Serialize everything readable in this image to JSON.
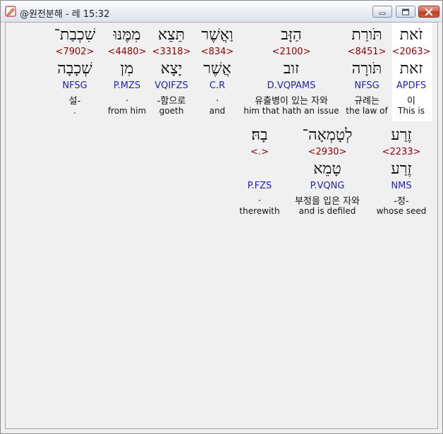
{
  "window": {
    "title": "@원전분해 - 레 15:32",
    "icon": "pencil-icon",
    "controls": {
      "minimize": "minimize-icon",
      "maximize": "maximize-icon",
      "close": "close-icon"
    }
  },
  "colors": {
    "strong": "#8b0000",
    "morph": "#2222b8",
    "text": "#111111",
    "selection": "#ffffff"
  },
  "words": [
    {
      "hebrew": "זֹאת",
      "strong": "<2063>",
      "lemma": "זאת",
      "morph": "APDFS",
      "korean": "이",
      "english": "This is",
      "selected": true
    },
    {
      "hebrew": "תֹּורַת",
      "strong": "<8451>",
      "lemma": "תֹּורָה",
      "morph": "NFSG",
      "korean": "규례는",
      "english": "the law of",
      "selected": false
    },
    {
      "hebrew": "הַזָּב",
      "strong": "<2100>",
      "lemma": "זוב",
      "morph": "D.VQPAMS",
      "korean": "유출병이 있는 자와",
      "english": "him that hath an issue",
      "selected": false
    },
    {
      "hebrew": "וַאֲשֶׁר",
      "strong": "<834>",
      "lemma": "אֲשֶׁר",
      "morph": "C.R",
      "korean": ".",
      "english": "and",
      "selected": false
    },
    {
      "hebrew": "תֵּצֵא",
      "strong": "<3318>",
      "lemma": "יָצָא",
      "morph": "VQIFZS",
      "korean": "-함으로",
      "english": "goeth",
      "selected": false
    },
    {
      "hebrew": "מִמֶּנּוּ",
      "strong": "<4480>",
      "lemma": "מִן",
      "morph": "P.MZS",
      "korean": ".",
      "english": "from him",
      "selected": false
    },
    {
      "hebrew": "שִׁכְבַת־",
      "strong": "<7902>",
      "lemma": "שְׁכָבָה",
      "morph": "NFSG",
      "korean": "설-",
      "english": ".",
      "selected": false
    },
    {
      "hebrew": "זֶרַע",
      "strong": "<2233>",
      "lemma": "זֶרַע",
      "morph": "NMS",
      "korean": "-정-",
      "english": "whose seed",
      "selected": false
    },
    {
      "hebrew": "לְטָמְאָה־",
      "strong": "<2930>",
      "lemma": "טָמֵא",
      "morph": "P.VQNG",
      "korean": "부정을 입은 자와",
      "english": "and is defiled",
      "selected": false
    },
    {
      "hebrew": "בָהּ׃",
      "strong": "<.>",
      "lemma": "",
      "morph": "P.FZS",
      "korean": ".",
      "english": "therewith",
      "selected": false
    }
  ]
}
